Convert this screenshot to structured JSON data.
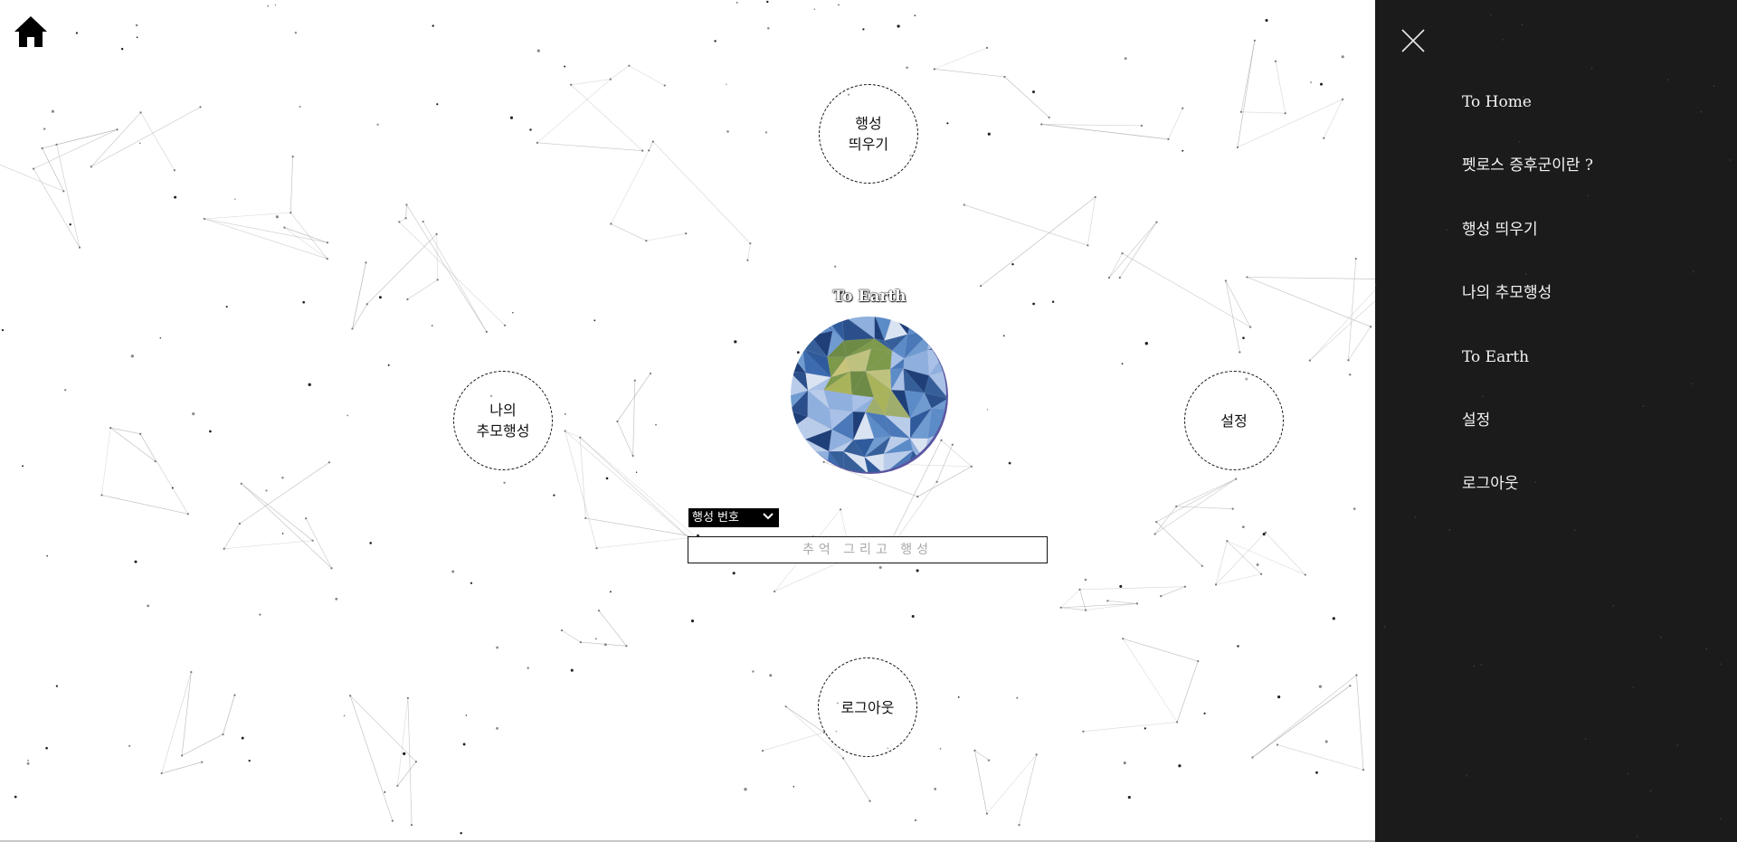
{
  "home": {
    "icon": "home-icon"
  },
  "planets": {
    "launch": {
      "line1": "행성",
      "line2": "띄우기"
    },
    "memorial": {
      "line1": "나의",
      "line2": "추모행성"
    },
    "settings": {
      "label": "설정"
    },
    "logout": {
      "label": "로그아웃"
    }
  },
  "earth": {
    "title": "To Earth"
  },
  "form": {
    "select_selected": "행성 번호",
    "input_placeholder": "추억 그리고 행성",
    "input_value": ""
  },
  "menu": {
    "close_icon": "close-icon",
    "items": [
      {
        "label": "To Home"
      },
      {
        "label": "펫로스 증후군이란 ?"
      },
      {
        "label": "행성 띄우기"
      },
      {
        "label": "나의 추모행성"
      },
      {
        "label": "To Earth"
      },
      {
        "label": "설정"
      },
      {
        "label": "로그아웃"
      }
    ]
  },
  "colors": {
    "sidebar_bg": "#1b1b1b",
    "sidebar_text": "#f4f4f4",
    "page_bg": "#ffffff",
    "select_bg": "#000000"
  }
}
